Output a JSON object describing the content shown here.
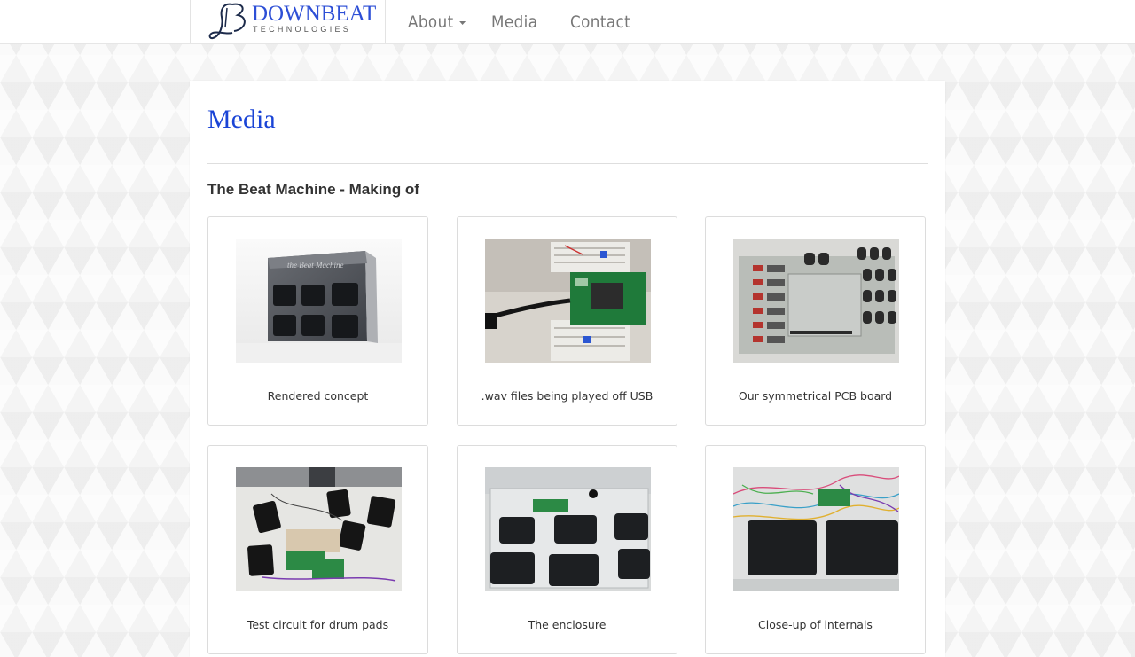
{
  "brand": {
    "title": "DOWNBEAT",
    "subtitle": "TECHNOLOGIES",
    "logo_icon": "downbeat-db-monogram",
    "color": "#2d4fd6"
  },
  "nav": {
    "items": [
      {
        "label": "About",
        "has_dropdown": true
      },
      {
        "label": "Media"
      },
      {
        "label": "Contact"
      }
    ]
  },
  "page": {
    "title": "Media",
    "title_color": "#1a44d6",
    "section_title": "The Beat Machine - Making of"
  },
  "gallery": [
    {
      "caption": "Rendered concept",
      "image": "rendered-concept-photo"
    },
    {
      "caption": ".wav files being played off USB",
      "image": "breadboard-usb-photo"
    },
    {
      "caption": "Our symmetrical PCB board",
      "image": "pcb-board-photo"
    },
    {
      "caption": "Test circuit for drum pads",
      "image": "test-circuit-photo"
    },
    {
      "caption": "The enclosure",
      "image": "enclosure-photo"
    },
    {
      "caption": "Close-up of internals",
      "image": "internals-closeup-photo"
    }
  ]
}
